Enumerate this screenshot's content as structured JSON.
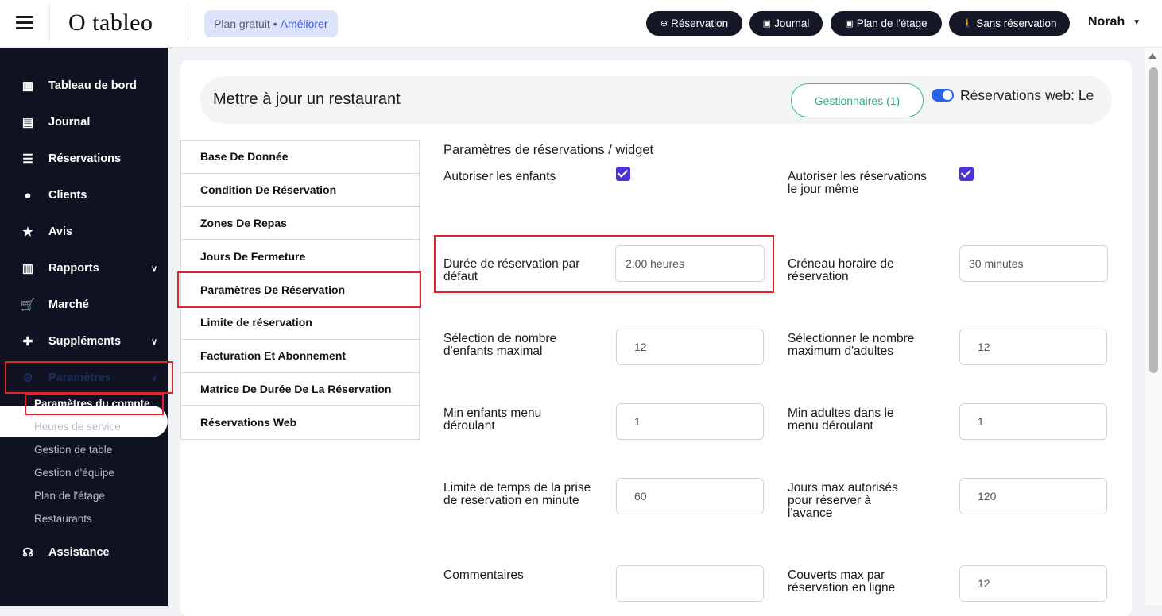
{
  "topbar": {
    "logo": "O tableo",
    "plan": "Plan gratuit •",
    "upgrade": "Améliorer",
    "buttons": {
      "reservation": "Réservation",
      "journal": "Journal",
      "floor_plan": "Plan de l'étage",
      "walk_in": "Sans réservation"
    },
    "user": "Norah"
  },
  "sidebar": {
    "items": {
      "dashboard": "Tableau de bord",
      "journal": "Journal",
      "reservations": "Réservations",
      "clients": "Clients",
      "reviews": "Avis",
      "reports": "Rapports",
      "market": "Marché",
      "addons": "Suppléments",
      "settings": "Paramètres",
      "support": "Assistance"
    },
    "sub": {
      "account": "Paramètres du compte",
      "service_hours": "Heures de service",
      "table_mgmt": "Gestion de table",
      "team_mgmt": "Gestion d'équipe",
      "floor_plan": "Plan de l'étage",
      "restaurants": "Restaurants"
    }
  },
  "header": {
    "title": "Mettre à jour un restaurant",
    "managers": "Gestionnaires (1)",
    "web_reservations": "Réservations web: Le"
  },
  "tabs": [
    "Base De Donnée",
    "Condition De Réservation",
    "Zones De Repas",
    "Jours De Fermeture",
    "Paramètres De Réservation",
    "Limite de réservation",
    "Facturation Et Abonnement",
    "Matrice De Durée De La Réservation",
    "Réservations Web"
  ],
  "form": {
    "section_title": "Paramètres de réservations / widget",
    "allow_children": {
      "label": "Autoriser les enfants",
      "checked": true
    },
    "allow_same_day": {
      "label": "Autoriser les réservations le jour même",
      "checked": true
    },
    "default_duration": {
      "label": "Durée de réservation par défaut",
      "value": "2:00 heures"
    },
    "time_slot": {
      "label": "Créneau horaire de réservation",
      "value": "30 minutes"
    },
    "max_children": {
      "label": "Sélection de nombre d'enfants maximal",
      "value": "12"
    },
    "max_adults": {
      "label": "Sélectionner le nombre maximum d'adultes",
      "value": "12"
    },
    "min_children": {
      "label": "Min enfants menu déroulant",
      "value": "1"
    },
    "min_adults": {
      "label": "Min adultes dans le menu déroulant",
      "value": "1"
    },
    "time_limit": {
      "label": "Limite de temps de la prise de reservation en minute",
      "value": "60"
    },
    "max_days": {
      "label": "Jours max autorisés pour réserver à l'avance",
      "value": "120"
    },
    "comments": {
      "label": "Commentaires",
      "value": ""
    },
    "max_covers": {
      "label": "Couverts max par réservation en ligne",
      "value": "12"
    }
  },
  "colors": {
    "sidebar_bg": "#0e1221",
    "accent_green": "#22b07d",
    "checkbox": "#4f33d8",
    "highlight_red": "#e0242b"
  }
}
